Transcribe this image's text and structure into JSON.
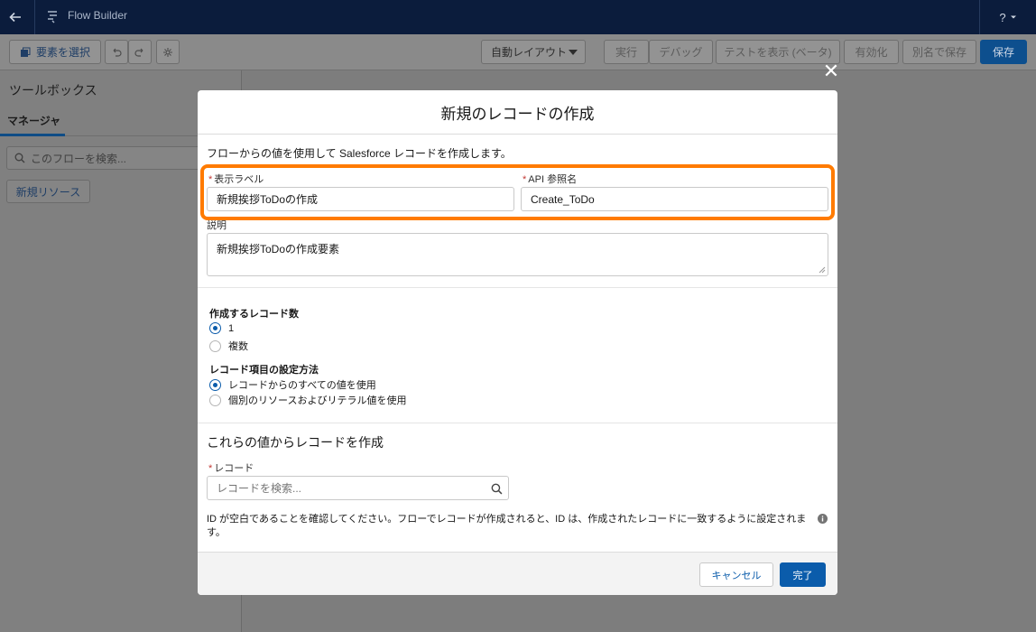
{
  "app": {
    "title": "Flow Builder",
    "help_label": "?"
  },
  "toolbar": {
    "select_elements": "要素を選択",
    "layout": "自動レイアウト",
    "run": "実行",
    "debug": "デバッグ",
    "view_test": "テストを表示 (ベータ)",
    "activate": "有効化",
    "save_as": "別名で保存",
    "save": "保存"
  },
  "left_panel": {
    "title": "ツールボックス",
    "tab": "マネージャ",
    "search_placeholder": "このフローを検索...",
    "new_resource": "新規リソース"
  },
  "modal": {
    "title": "新規のレコードの作成",
    "description": "フローからの値を使用して Salesforce レコードを作成します。",
    "label_field": {
      "label": "表示ラベル",
      "value": "新規挨拶ToDoの作成"
    },
    "api_field": {
      "label": "API 参照名",
      "value": "Create_ToDo"
    },
    "description_field": {
      "label": "説明",
      "value": "新規挨拶ToDoの作成要素"
    },
    "record_count": {
      "title": "作成するレコード数",
      "options": [
        "1",
        "複数"
      ],
      "selected": "1"
    },
    "field_method": {
      "title": "レコード項目の設定方法",
      "options": [
        "レコードからのすべての値を使用",
        "個別のリソースおよびリテラル値を使用"
      ],
      "selected": "レコードからのすべての値を使用"
    },
    "create_section": {
      "title": "これらの値からレコードを作成",
      "record_label": "レコード",
      "record_placeholder": "レコードを検索..."
    },
    "info_text": "ID が空白であることを確認してください。フローでレコードが作成されると、ID は、作成されたレコードに一致するように設定されます。",
    "cancel": "キャンセル",
    "done": "完了"
  },
  "colors": {
    "highlight": "#ff7b00",
    "brand": "#0b5cab",
    "header_bg": "#0b1c3c"
  }
}
